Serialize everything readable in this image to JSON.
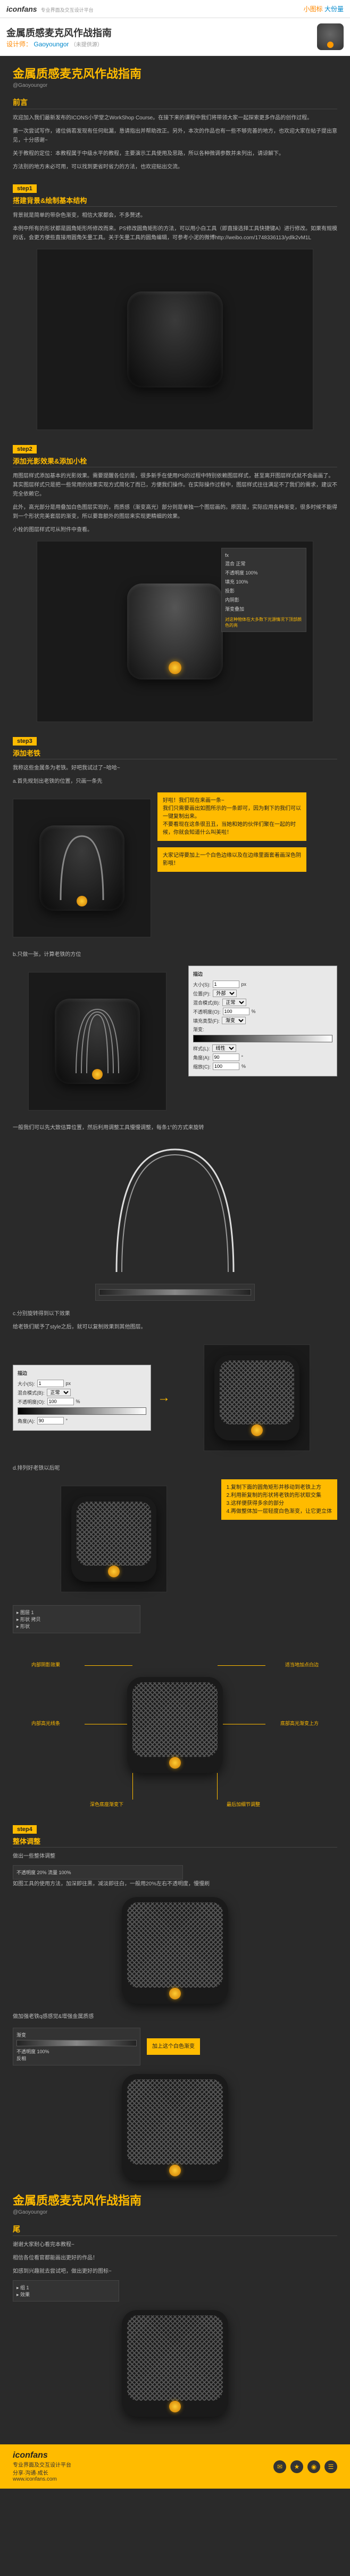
{
  "header": {
    "logo": "iconfans",
    "logo_sub": "专业界面及交互设计平台",
    "tagline_a": "小图标",
    "tagline_b": "大份量"
  },
  "titlebar": {
    "title": "金属质感麦克风作战指南",
    "designer_label": "设计师：",
    "designer_name": "Gaoyoungor",
    "designer_note": "（未提供源）"
  },
  "main": {
    "title": "金属质感麦克风作战指南",
    "author": "@Gaoyoungor"
  },
  "preface": {
    "label": "前言",
    "p1": "欢迎加入我们最新发布的ICONS小学堂之WorkShop Course。在接下来的课程中我们将带领大家一起探索更多作品的创作过程。",
    "p2": "第一次尝试写作，诸位倘若发现有任何纰漏，恳请指出并帮助改正。另外，本次的作品也有一些不够完善的地方，也欢迎大家在帖子提出意见，十分感谢~",
    "p3": "关于教程的定位：本教程属于中级水平的教程，主要演示工具使用及思路，所以各种微调参数并未列出，请谅解下。",
    "p4": "方法别的地方未必可用，可以找到更省时省力的方法，也欢迎贴出交流。"
  },
  "step1": {
    "tag": "step1",
    "title": "搭建背景&绘制基本结构",
    "p1": "背景就是简单的带杂色渐变，相信大家都会，不多赘述。",
    "p2": "本例中所有的形状都是圆角矩形所修改而来。PS修改圆角矩形的方法，可以用小白工具（即直接选择工具快捷键A）进行修改。如果有规模的话，会更方便些直接用圆角矢量工具。关于矢量工具的圆角编辑，可参考小泥的微博http://weibo.com/1748336113/ydlk2vM1L"
  },
  "step2": {
    "tag": "step2",
    "title": "添加光影效果&添加小栓",
    "p1": "用图层样式添加基本的光影效果。需要提醒各位的是，很多新手在使用PS的过程中特别依赖图层样式，甚至离开图层样式就不会画画了。其实图层样式只是把一些常用的效果实现方式简化了而已，方便我们操作。在实际操作过程中，图层样式往往满足不了我们的需求，建议不完全依赖它。",
    "p2": "此外，高光部分是用叠加白色图层实现的，而质感（渐变高光）部分则是单独一个图层画的。原因是，实际应用各种渐变，很多时候不能得到一个形状完美套层的渐变，所以要靠额外的图层来实现更精细的效果。",
    "p3": "小栓的图层样式可从附件中查看。"
  },
  "panel_fx": {
    "title": "fx",
    "rows": [
      "混合 正常",
      "不透明度 100%",
      "填充 100%",
      "投影",
      "内阴影",
      "渐变叠加"
    ],
    "note": "对这种物体在大多数下光源情况下顶部颜色的亮"
  },
  "step3": {
    "tag": "step3",
    "title": "添加老铁",
    "p1": "我称这些金属条为老铁。好吧我试过了~哈哈~",
    "num_a": "a.首先规划出老铁的位置，只画一条先",
    "callout1": "好啦！我们现在来画一条~\n我们只需要画出如图所示的一条即可，因为剩下的我们可以一键复制出来。\n不要看现在这条很丑丑，当她和她的伙伴们聚在一起的时候，你就会知道什么叫美啦！",
    "callout2": "大家记得要加上一个白色边缘以及在边缘里面套着画深色阴影哦！",
    "num_b": "b.只做一张，计算老铁的方位",
    "wire_note": "一般我们可以先大致估算位置，然后利用调整工具慢慢调整，每条1°的方式来旋转",
    "num_c": "c.分别旋转得到以下效果",
    "ps_stroke": {
      "title": "描边",
      "size_label": "大小(S):",
      "size_val": "1",
      "pos_label": "位置(P):",
      "pos_val": "外部",
      "blend_label": "混合模式(B):",
      "blend_val": "正常",
      "opacity_label": "不透明度(O):",
      "opacity_val": "100",
      "fill_label": "填充类型(F):",
      "fill_val": "渐变",
      "grad_label": "渐变:",
      "style_label": "样式(L):",
      "style_val": "线性",
      "angle_label": "角度(A):",
      "angle_val": "90",
      "scale_label": "缩放(C):",
      "scale_val": "100"
    },
    "propagate_note": "给老铁们赋予了style之后，就可以复制效果到其他图层。",
    "num_d": "d.排列好老铁以后呢",
    "callout3": "1.复制下面的圆角矩形并移动到老铁上方\n2.利用新复制的形状将老铁的形状取交集\n3.这样便获得多余的部分\n4.再做整体加一层轻度白色渐变，让它更立体"
  },
  "annotations": {
    "a1": "内部阴影效果",
    "a2": "适当地加点白边",
    "a3": "内部高光线条",
    "a4": "底部高光渐变上方",
    "a5": "深色底座渐变下",
    "a6": "最后加细节调整"
  },
  "step4": {
    "tag": "step4",
    "title": "整体调整",
    "p1": "做出一些整体调整",
    "toolbar": "不透明度 20%  流量 100%",
    "p2": "如图工具的使用方法，加深即往黑，减淡即往白，一般用20%左右不透明度，慢慢刷",
    "p3": "做加强老铁q感感觉&增强金属质感",
    "grad_note": "加上这个白色渐变",
    "end_title": "金属质感麦克风作战指南",
    "end_author": "@Gaoyoungor",
    "end_label": "尾",
    "end_p1": "谢谢大家耐心看完本教程~",
    "end_p2": "相信各位看官都能画出更好的作品！",
    "end_p3": "如感到兴趣就去尝试吧，做出更好的图标~"
  },
  "dark_panel2": {
    "rows": [
      "渐变",
      "不透明度 100%",
      "反相"
    ]
  },
  "footer": {
    "logo": "iconfans",
    "line1": "专业界面及交互设计平台",
    "line2": "分享·沟通·成长",
    "url": "www.iconfans.com"
  }
}
